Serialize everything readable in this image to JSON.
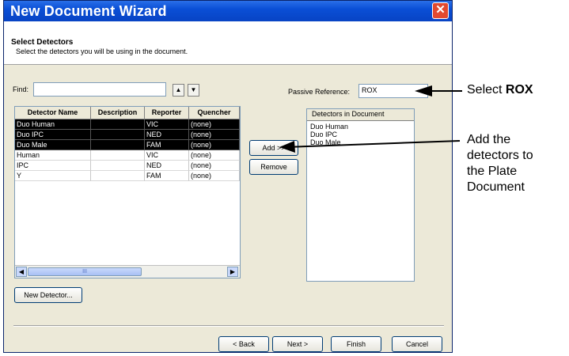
{
  "window": {
    "title": "New Document Wizard",
    "close_glyph": "✕"
  },
  "header": {
    "title": "Select Detectors",
    "subtitle": "Select the detectors you will be using in the document."
  },
  "find": {
    "label": "Find:",
    "value": "",
    "up_glyph": "▲",
    "down_glyph": "▼"
  },
  "passive_reference": {
    "label": "Passive Reference:",
    "value": "ROX"
  },
  "detector_table": {
    "columns": [
      "Detector Name",
      "Description",
      "Reporter",
      "Quencher"
    ],
    "rows": [
      {
        "name": "Duo Human",
        "description": "",
        "reporter": "VIC",
        "quencher": "(none)",
        "selected": true
      },
      {
        "name": "Duo IPC",
        "description": "",
        "reporter": "NED",
        "quencher": "(none)",
        "selected": true
      },
      {
        "name": "Duo Male",
        "description": "",
        "reporter": "FAM",
        "quencher": "(none)",
        "selected": true
      },
      {
        "name": "Human",
        "description": "",
        "reporter": "VIC",
        "quencher": "(none)",
        "selected": false
      },
      {
        "name": "IPC",
        "description": "",
        "reporter": "NED",
        "quencher": "(none)",
        "selected": false
      },
      {
        "name": "Y",
        "description": "",
        "reporter": "FAM",
        "quencher": "(none)",
        "selected": false
      }
    ],
    "scroll_thumb_glyph": "III",
    "scroll_left_glyph": "◀",
    "scroll_right_glyph": "▶"
  },
  "buttons": {
    "add": "Add >>",
    "remove": "Remove",
    "new_detector": "New Detector...",
    "back": "< Back",
    "next": "Next >",
    "finish": "Finish",
    "cancel": "Cancel"
  },
  "detectors_in_document": {
    "header": "Detectors in Document",
    "items": [
      "Duo Human",
      "Duo IPC",
      "Duo Male"
    ]
  },
  "callouts": {
    "rox_prefix": "Select ",
    "rox_bold": "ROX",
    "add_lines": [
      "Add the",
      "detectors to",
      "the Plate",
      "Document"
    ]
  },
  "colors": {
    "titlebar": "#0a4fd6",
    "dialog_bg": "#ece9d8",
    "selection": "#000000"
  }
}
